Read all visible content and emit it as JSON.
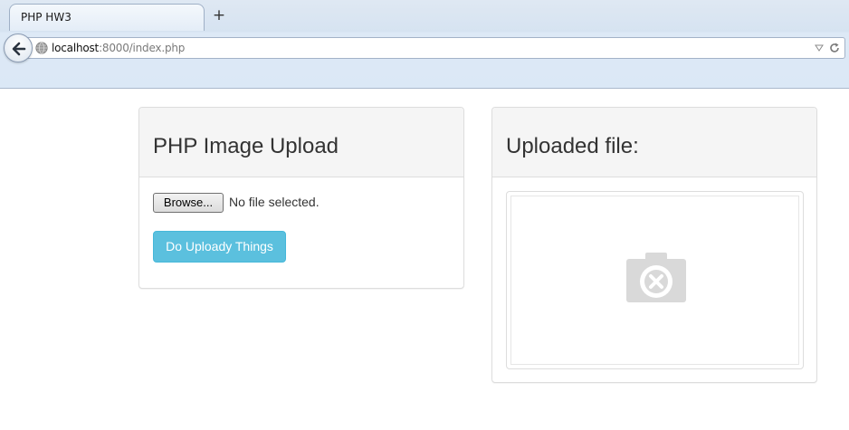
{
  "browser": {
    "tab_title": "PHP HW3",
    "new_tab_glyph": "+",
    "url_host": "localhost",
    "url_rest": ":8000/index.php"
  },
  "upload_panel": {
    "title": "PHP Image Upload",
    "browse_label": "Browse...",
    "file_status": "No file selected.",
    "submit_label": "Do Uploady Things"
  },
  "result_panel": {
    "title": "Uploaded file:",
    "image_icon": "broken-camera-icon"
  },
  "colors": {
    "button_info": "#5bc0de",
    "panel_heading_bg": "#f5f5f5",
    "panel_border": "#dddddd",
    "icon_gray": "#d9d9d9"
  }
}
